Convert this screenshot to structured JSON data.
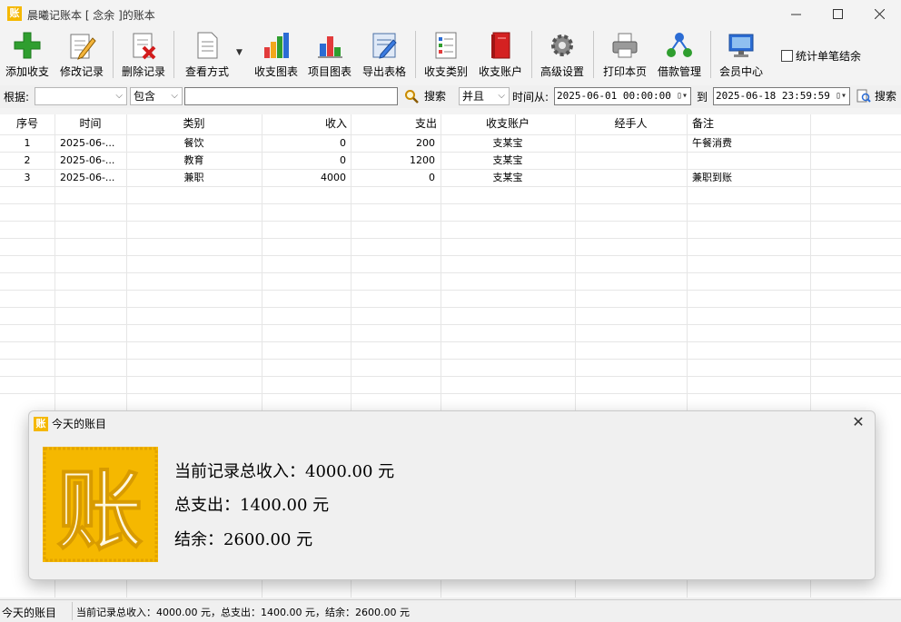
{
  "window": {
    "icon_text": "账",
    "title": "晨曦记账本   [ 念余 ]的账本"
  },
  "toolbar": {
    "add": "添加收支",
    "edit": "修改记录",
    "delete": "删除记录",
    "view": "查看方式",
    "chart_income": "收支图表",
    "chart_item": "项目图表",
    "export": "导出表格",
    "category": "收支类别",
    "account": "收支账户",
    "settings": "高级设置",
    "print": "打印本页",
    "loan": "借款管理",
    "member": "会员中心",
    "stat_checkbox": "统计单笔结余"
  },
  "filter": {
    "by_label": "根据:",
    "by_value": "",
    "match_value": "包含",
    "keyword": "",
    "search": "搜索",
    "logic_value": "并且",
    "time_from_label": "时间从:",
    "date_from": "2025-06-01 00:00:00",
    "to_label": "到",
    "date_to": "2025-06-18 23:59:59",
    "search2": "搜索"
  },
  "table": {
    "headers": [
      "序号",
      "时间",
      "类别",
      "收入",
      "支出",
      "收支账户",
      "经手人",
      "备注"
    ],
    "rows": [
      [
        "1",
        "2025-06-...",
        "餐饮",
        "0",
        "200",
        "支某宝",
        "",
        "午餐消费"
      ],
      [
        "2",
        "2025-06-...",
        "教育",
        "0",
        "1200",
        "支某宝",
        "",
        ""
      ],
      [
        "3",
        "2025-06-...",
        "兼职",
        "4000",
        "0",
        "支某宝",
        "",
        "兼职到账"
      ]
    ]
  },
  "dialog": {
    "icon_text": "账",
    "title": "今天的账目",
    "close": "✕",
    "logo_text": "账",
    "income_line": "当前记录总收入：4000.00 元",
    "expense_line": "总支出：1400.00 元",
    "balance_line": "结余：2600.00 元"
  },
  "status": {
    "label": "今天的账目",
    "summary": "当前记录总收入：4000.00 元，总支出：1400.00 元，结余：2600.00 元"
  }
}
